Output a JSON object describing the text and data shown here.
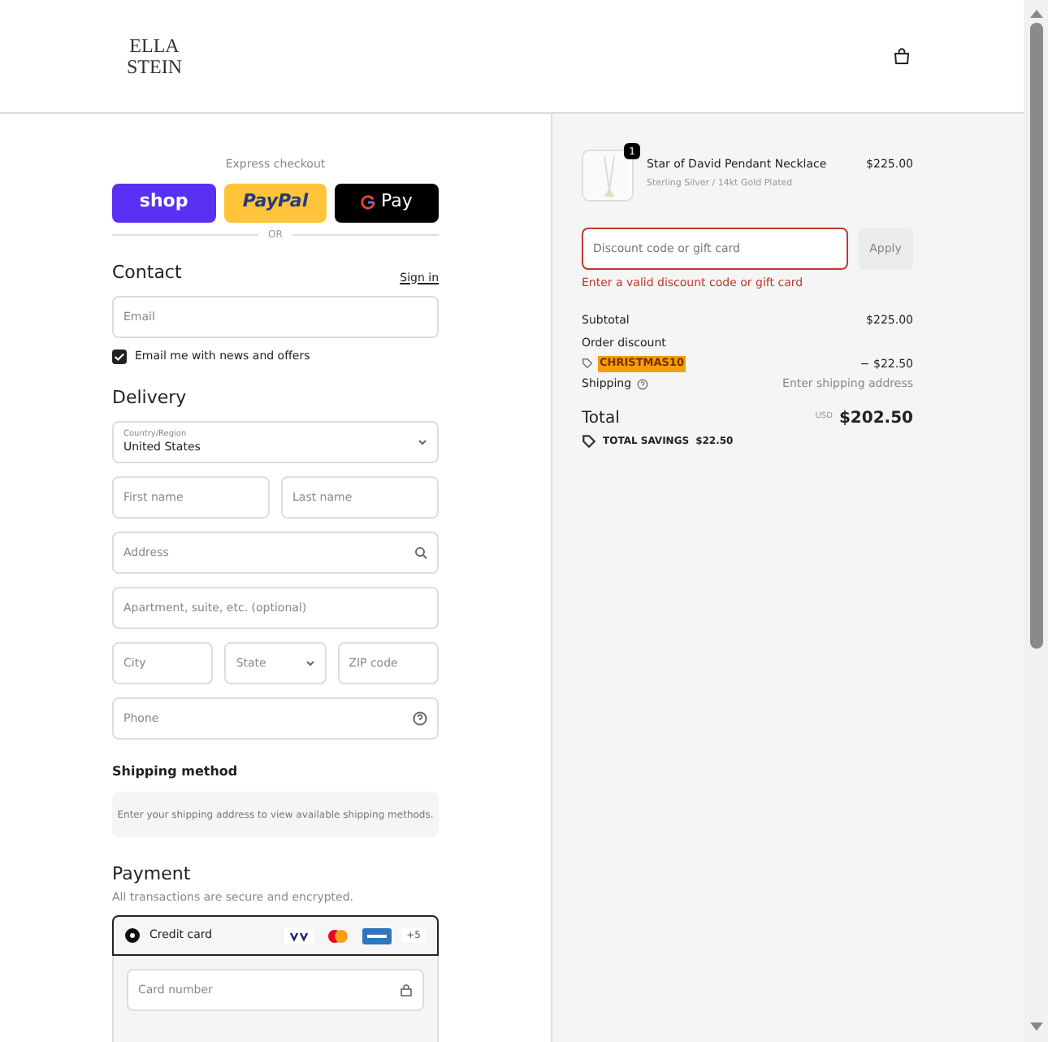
{
  "header": {
    "logo_line_1": "ELLA",
    "logo_line_2": "STEIN"
  },
  "express": {
    "title": "Express checkout",
    "buttons": [
      {
        "kind": "shop",
        "label": "shop"
      },
      {
        "kind": "paypal",
        "label": "PayPal"
      },
      {
        "kind": "gpay",
        "label": "Pay"
      }
    ],
    "divider": "OR"
  },
  "contact": {
    "title": "Contact",
    "sign_in": "Sign in",
    "email": {
      "placeholder": "Email"
    },
    "newsletter": {
      "label": "Email me with news and offers",
      "checked": true
    }
  },
  "delivery": {
    "title": "Delivery",
    "country": {
      "label": "Country/Region",
      "value": "United States"
    },
    "fields": [
      [
        {
          "kind": "text",
          "placeholder": "First name"
        },
        {
          "kind": "text",
          "placeholder": "Last name"
        }
      ],
      [
        {
          "kind": "search",
          "placeholder": "Address"
        }
      ],
      [
        {
          "kind": "text",
          "placeholder": "Apartment, suite, etc. (optional)"
        }
      ],
      [
        {
          "kind": "text",
          "placeholder": "City"
        },
        {
          "kind": "select",
          "placeholder": "State"
        },
        {
          "kind": "text",
          "placeholder": "ZIP code"
        }
      ],
      [
        {
          "kind": "help",
          "placeholder": "Phone"
        }
      ]
    ]
  },
  "shipping_method": {
    "title": "Shipping method",
    "notice": "Enter your shipping address to view available shipping methods."
  },
  "payment": {
    "title": "Payment",
    "subtitle": "All transactions are secure and encrypted.",
    "method": {
      "label": "Credit card",
      "selected": true,
      "more": "+5"
    },
    "card_number": {
      "placeholder": "Card number"
    }
  },
  "summary": {
    "item": {
      "name": "Star of David Pendant Necklace",
      "variant": "Sterling Silver / 14kt Gold Plated",
      "price": "$225.00",
      "quantity": "1"
    },
    "discount": {
      "placeholder": "Discount code or gift card",
      "apply": "Apply",
      "error": "Enter a valid discount code or gift card"
    },
    "subtotal": {
      "label": "Subtotal",
      "value": "$225.00"
    },
    "order_discount": {
      "label": "Order discount",
      "code": "CHRISTMAS10",
      "value": "− $22.50"
    },
    "shipping": {
      "label": "Shipping",
      "value": "Enter shipping address"
    },
    "total": {
      "label": "Total",
      "currency": "USD",
      "value": "$202.50"
    },
    "savings": {
      "label": "TOTAL SAVINGS",
      "value": "$22.50"
    }
  }
}
